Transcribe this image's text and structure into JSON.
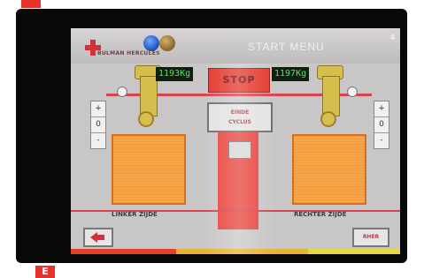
{
  "tags": {
    "top": "",
    "bottom": "E"
  },
  "header": {
    "brand": "BULMAN HERCULES",
    "title": "START MENU",
    "page": "4"
  },
  "controls": {
    "stop_label": "STOP",
    "cycle_label_line1": "EINDE",
    "cycle_label_line2": "CYCLUS",
    "next_label": "RHER"
  },
  "left": {
    "readout": "1193Kg",
    "stepper": {
      "plus": "+",
      "value": "0",
      "minus": "-"
    },
    "label": "LINKER ZIJDE"
  },
  "right": {
    "readout": "1197Kg",
    "stepper": {
      "plus": "+",
      "value": "0",
      "minus": "-"
    },
    "label": "RECHTER ZIJDE"
  },
  "icons": {
    "logo": "red-cross-logo-icon",
    "back": "back-arrow-icon",
    "balls": "status-balls-icon"
  },
  "colors": {
    "accent_red": "#e33a2e",
    "arm_yellow": "#d8be4c",
    "panel_orange": "#f59a3a",
    "lcd_green": "#59e368"
  }
}
